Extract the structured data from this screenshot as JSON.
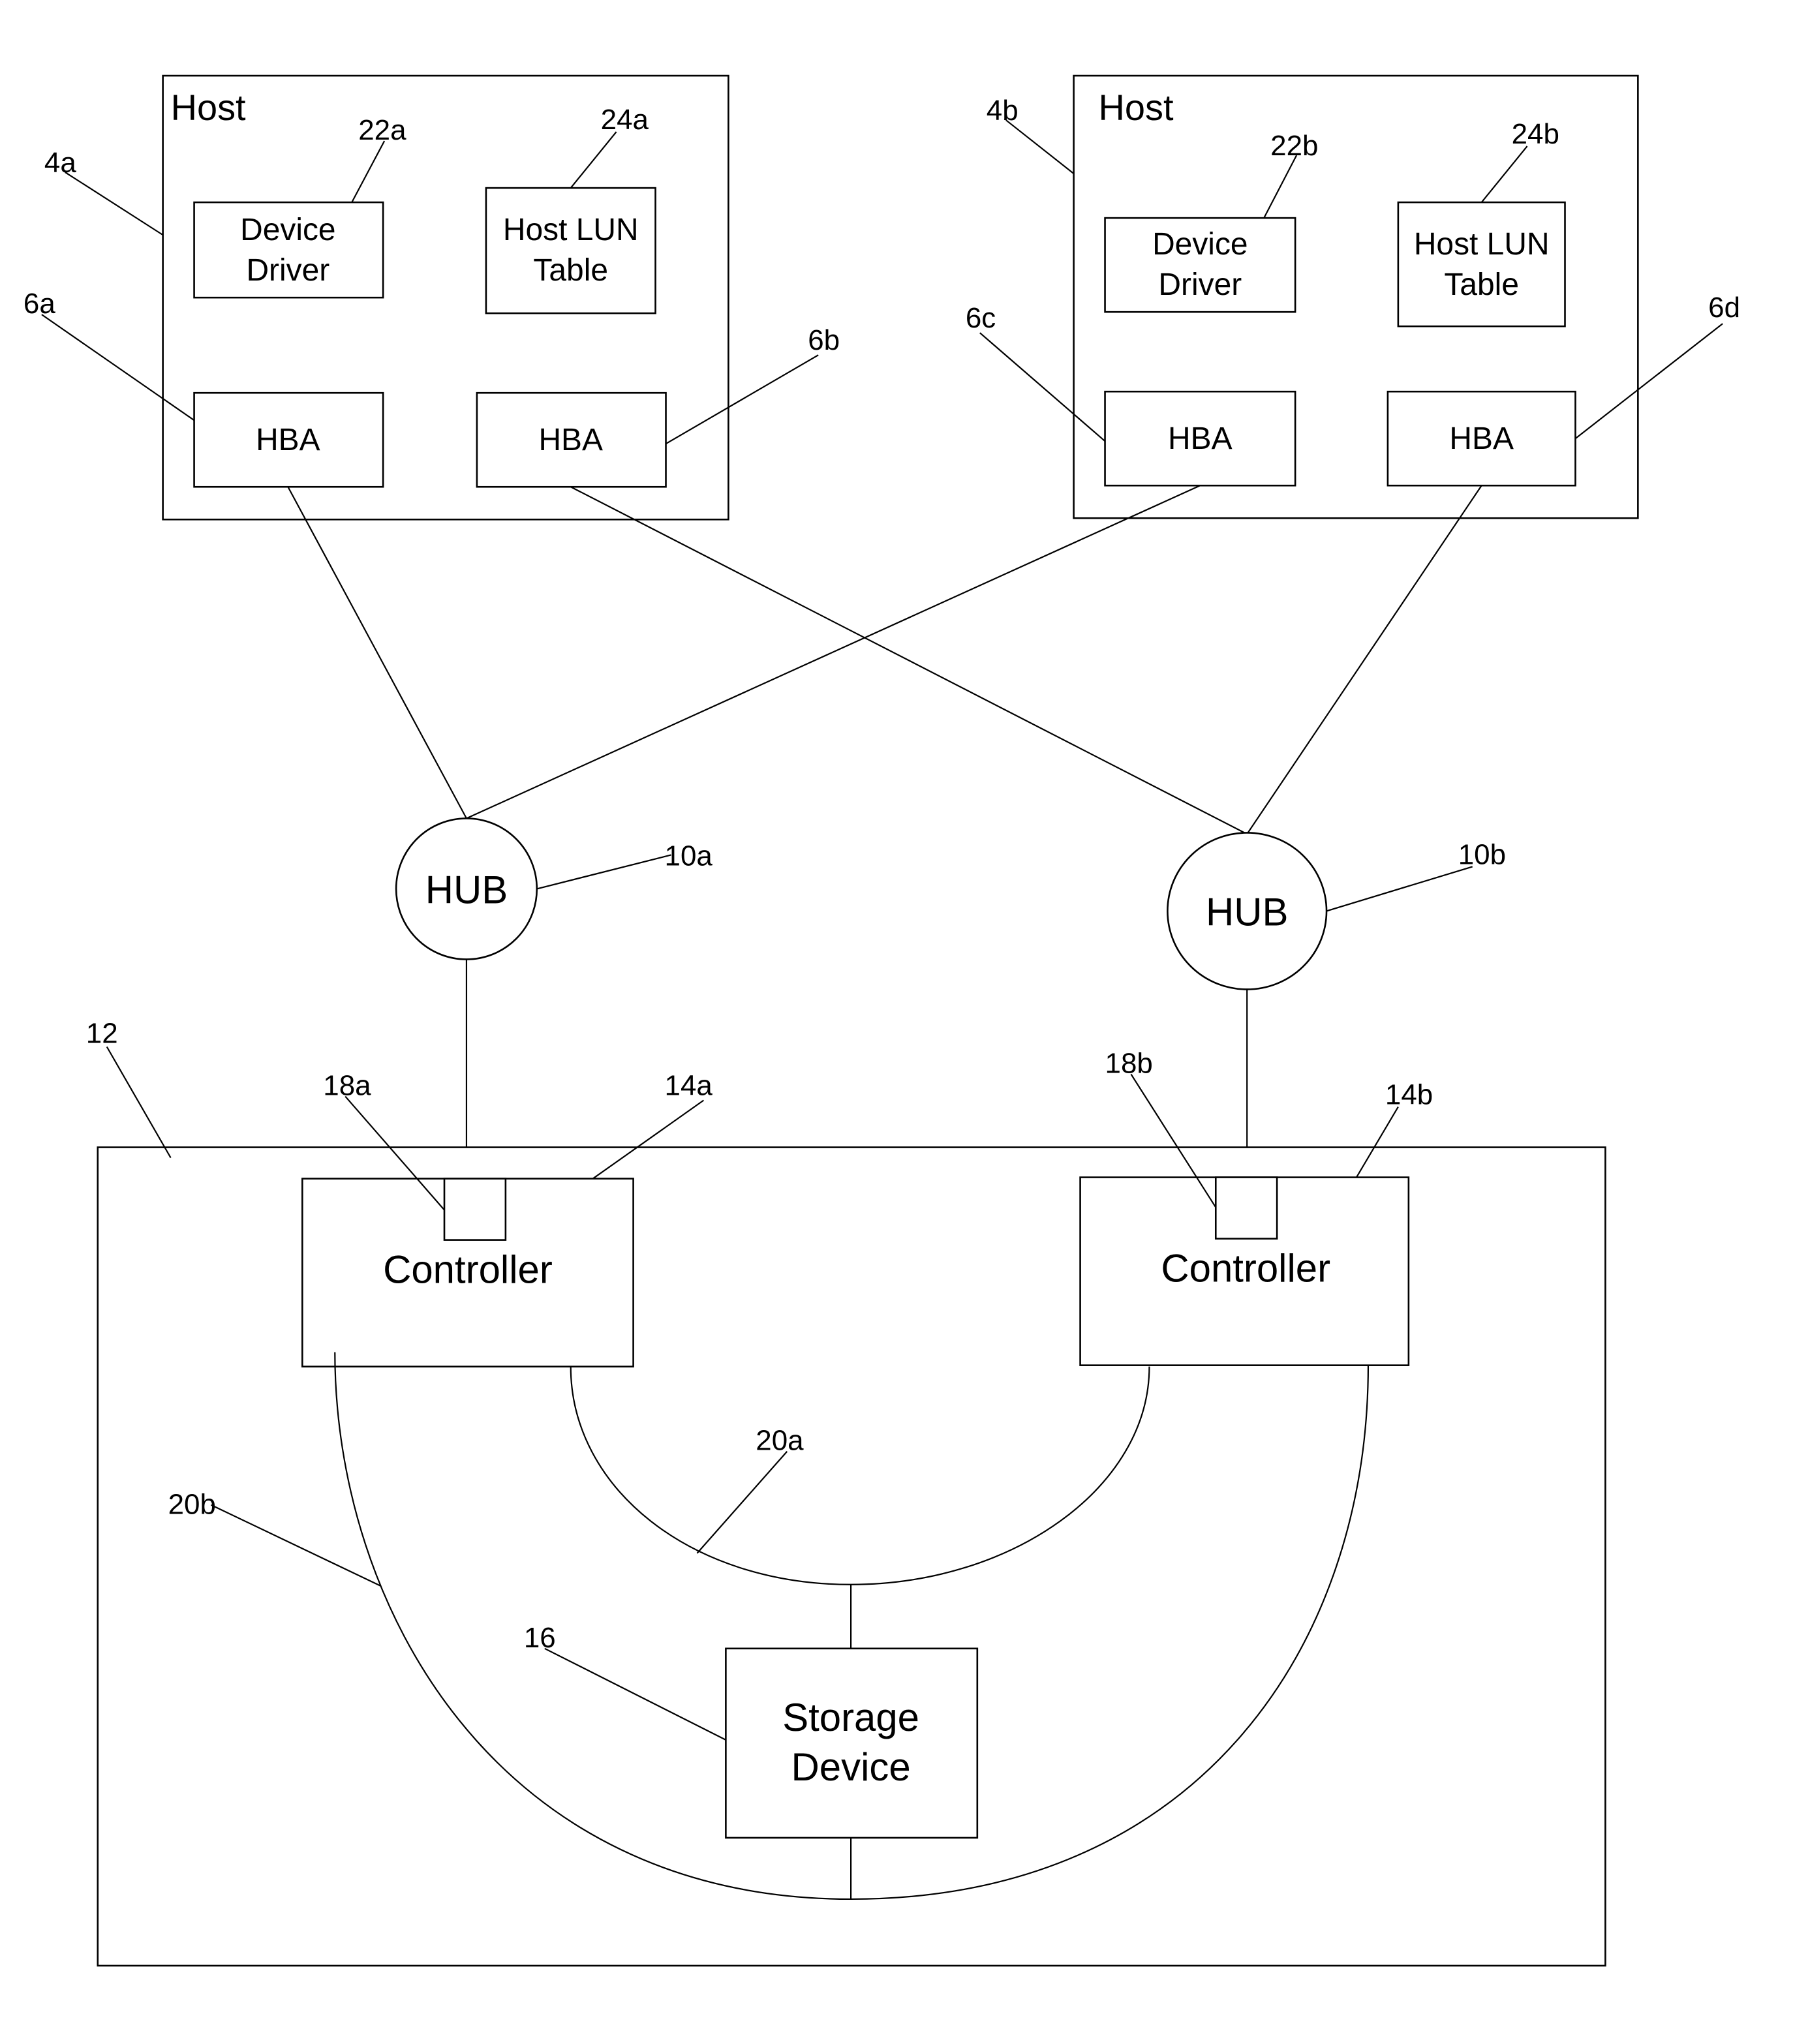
{
  "diagram": {
    "hosts": [
      {
        "ref": "4a",
        "title": "Host",
        "device_driver": {
          "ref": "22a",
          "line1": "Device",
          "line2": "Driver"
        },
        "lun_table": {
          "ref": "24a",
          "line1": "Host LUN",
          "line2": "Table"
        },
        "hbas": [
          {
            "ref": "6a",
            "label": "HBA"
          },
          {
            "ref": "6b",
            "label": "HBA"
          }
        ]
      },
      {
        "ref": "4b",
        "title": "Host",
        "device_driver": {
          "ref": "22b",
          "line1": "Device",
          "line2": "Driver"
        },
        "lun_table": {
          "ref": "24b",
          "line1": "Host LUN",
          "line2": "Table"
        },
        "hbas": [
          {
            "ref": "6c",
            "label": "HBA"
          },
          {
            "ref": "6d",
            "label": "HBA"
          }
        ]
      }
    ],
    "hubs": [
      {
        "ref": "10a",
        "label": "HUB"
      },
      {
        "ref": "10b",
        "label": "HUB"
      }
    ],
    "storage_system": {
      "ref": "12",
      "controllers": [
        {
          "ref": "14a",
          "label": "Controller",
          "port_ref": "18a"
        },
        {
          "ref": "14b",
          "label": "Controller",
          "port_ref": "18b"
        }
      ],
      "paths": [
        {
          "ref": "20a"
        },
        {
          "ref": "20b"
        }
      ],
      "storage_device": {
        "ref": "16",
        "line1": "Storage",
        "line2": "Device"
      }
    }
  }
}
